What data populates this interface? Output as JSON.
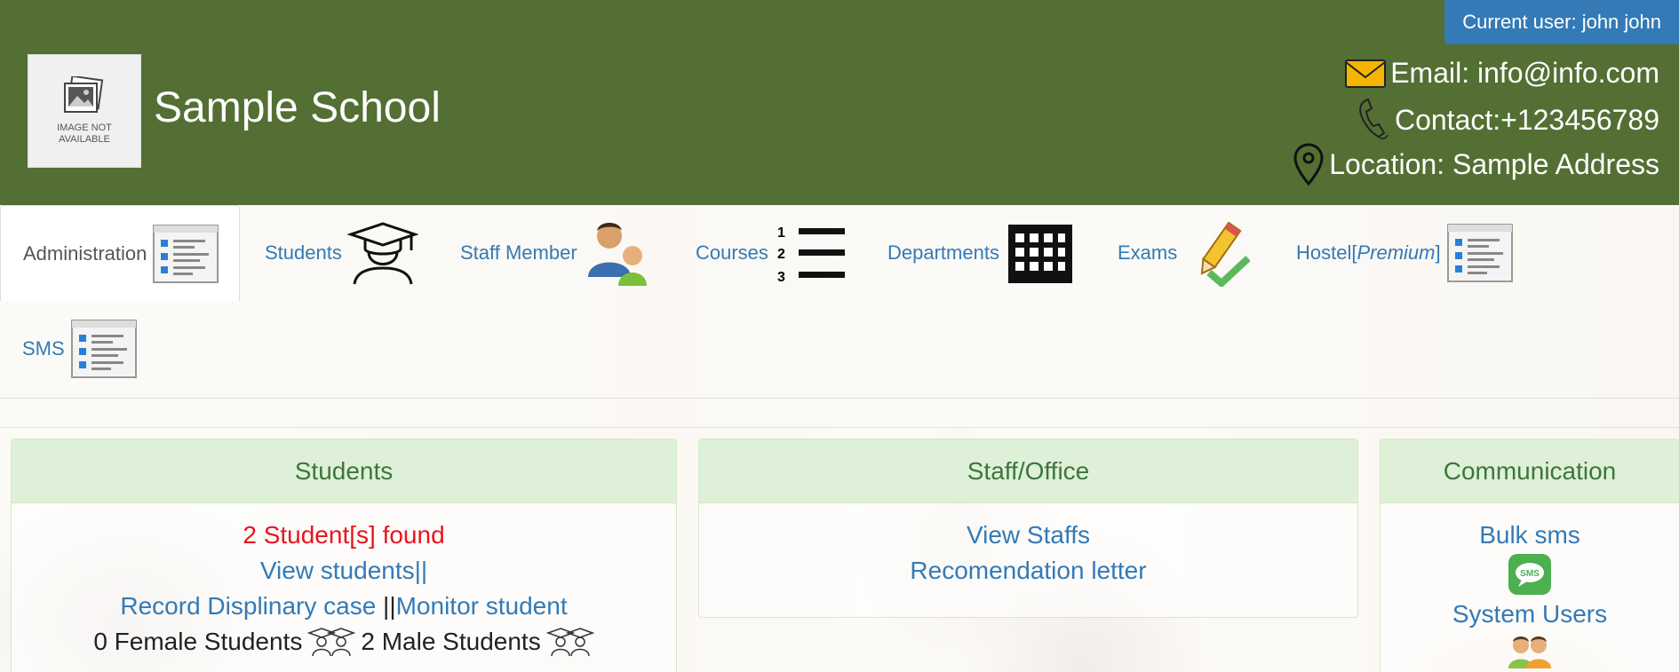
{
  "header": {
    "school_name": "Sample School",
    "logo_text": "IMAGE NOT\nAVAILABLE",
    "current_user": "Current user: john john",
    "email": "Email: info@info.com",
    "contact": "Contact:+123456789",
    "location": "Location: Sample Address",
    "colors": {
      "header_bg": "#536f34",
      "user_badge": "#337ab7"
    }
  },
  "nav": {
    "tabs": [
      {
        "label": "Administration",
        "icon": "list-document-icon",
        "active": true
      },
      {
        "label": "Students",
        "icon": "graduate-icon"
      },
      {
        "label": "Staff Member",
        "icon": "staff-people-icon"
      },
      {
        "label": "Courses",
        "icon": "numbered-list-icon"
      },
      {
        "label": "Departments",
        "icon": "building-icon"
      },
      {
        "label": "Exams",
        "icon": "pencil-check-icon"
      },
      {
        "label": "Hostel",
        "label_suffix": "Premium",
        "icon": "list-document-icon"
      },
      {
        "label": "SMS",
        "icon": "list-document-icon"
      }
    ]
  },
  "panels": {
    "students": {
      "title": "Students",
      "found": "2 Student[s] found",
      "view": "View students",
      "view_sep": "||",
      "record": "Record Displinary case",
      "record_sep": " ||",
      "monitor": "Monitor student",
      "female": "0 Female Students",
      "male": "2 Male Students"
    },
    "staff": {
      "title": "Staff/Office",
      "view": "View Staffs",
      "letter": "Recomendation letter"
    },
    "communication": {
      "title": "Communication",
      "bulk": "Bulk sms",
      "sms_icon_text": "SMS",
      "users": "System Users"
    }
  }
}
